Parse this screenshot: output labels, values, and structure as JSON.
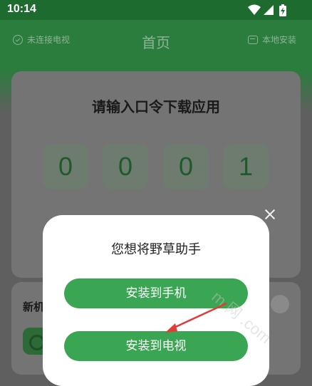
{
  "status_bar": {
    "time": "10:14",
    "icons": [
      "wifi-icon",
      "signal-icon",
      "battery-charging-icon"
    ]
  },
  "header": {
    "left_label": "未连接电视",
    "title": "首页",
    "right_label": "本地安装"
  },
  "code_card": {
    "title": "请输入口令下载应用",
    "digits": [
      "0",
      "0",
      "0",
      "1"
    ]
  },
  "second_card": {
    "title": "新机"
  },
  "dialog": {
    "title": "您想将野草助手",
    "install_phone_label": "安装到手机",
    "install_tv_label": "安装到电视"
  },
  "watermark": {
    "text": "m 网 .com"
  },
  "colors": {
    "primary_green": "#3aa552",
    "status_bar": "#1d6b2f",
    "annotation_arrow": "#e53935"
  }
}
